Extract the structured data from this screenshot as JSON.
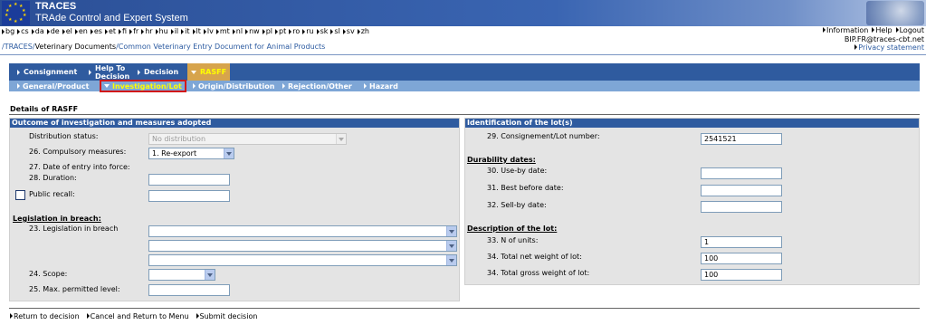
{
  "header": {
    "title": "TRACES",
    "subtitle": "TRAde Control and Expert System"
  },
  "languages": [
    "bg",
    "cs",
    "da",
    "de",
    "el",
    "en",
    "es",
    "et",
    "fi",
    "fr",
    "hr",
    "hu",
    "il",
    "it",
    "lt",
    "lv",
    "mt",
    "nl",
    "nw",
    "pl",
    "pt",
    "ro",
    "ru",
    "sk",
    "sl",
    "sv",
    "zh"
  ],
  "top_links": {
    "information": "Information",
    "help": "Help",
    "logout": "Logout",
    "user_email": "BIP.FR@traces-cbt.net",
    "privacy": "Privacy statement"
  },
  "breadcrumb": {
    "root": "/TRACES/",
    "current": "Veterinary Documents",
    "sep": "/",
    "page": "Common Veterinary Entry Document for Animal Products"
  },
  "tabs": {
    "consignment": "Consignment",
    "help_line1": "Help To",
    "help_line2": "Decision",
    "decision": "Decision",
    "rasff": "RASFF"
  },
  "subtabs": {
    "general": "General/Product",
    "investigation": "Investigation/Lot",
    "origin": "Origin/Distribution",
    "rejection": "Rejection/Other",
    "hazard": "Hazard"
  },
  "section_title": "Details of RASFF",
  "left_panel": {
    "title": "Outcome of investigation and measures adopted",
    "distribution_status_label": "Distribution status:",
    "distribution_status_value": "No distribution",
    "compulsory_label": "26. Compulsory measures:",
    "compulsory_value": "1. Re-export",
    "date_entry_label": "27. Date of entry into force:",
    "duration_label": "28. Duration:",
    "public_recall_label": "Public recall:",
    "legislation_head": "Legislation in breach:",
    "legislation_label": "23. Legislation in breach",
    "scope_label": "24. Scope:",
    "max_level_label": "25. Max. permitted level:"
  },
  "right_panel": {
    "title": "Identification of the lot(s)",
    "lot_number_label": "29. Consignement/Lot number:",
    "lot_number_value": "2541521",
    "durability_head": "Durability dates:",
    "use_by_label": "30. Use-by date:",
    "best_before_label": "31. Best before date:",
    "sell_by_label": "32. Sell-by date:",
    "description_head": "Description of the lot:",
    "units_label": "33. N of units:",
    "units_value": "1",
    "net_weight_label": "34. Total net weight of lot:",
    "net_weight_value": "100",
    "gross_weight_label": "34. Total gross weight of lot:",
    "gross_weight_value": "100"
  },
  "footer": {
    "return": "Return to decision",
    "cancel": "Cancel and Return to Menu",
    "submit": "Submit decision"
  }
}
